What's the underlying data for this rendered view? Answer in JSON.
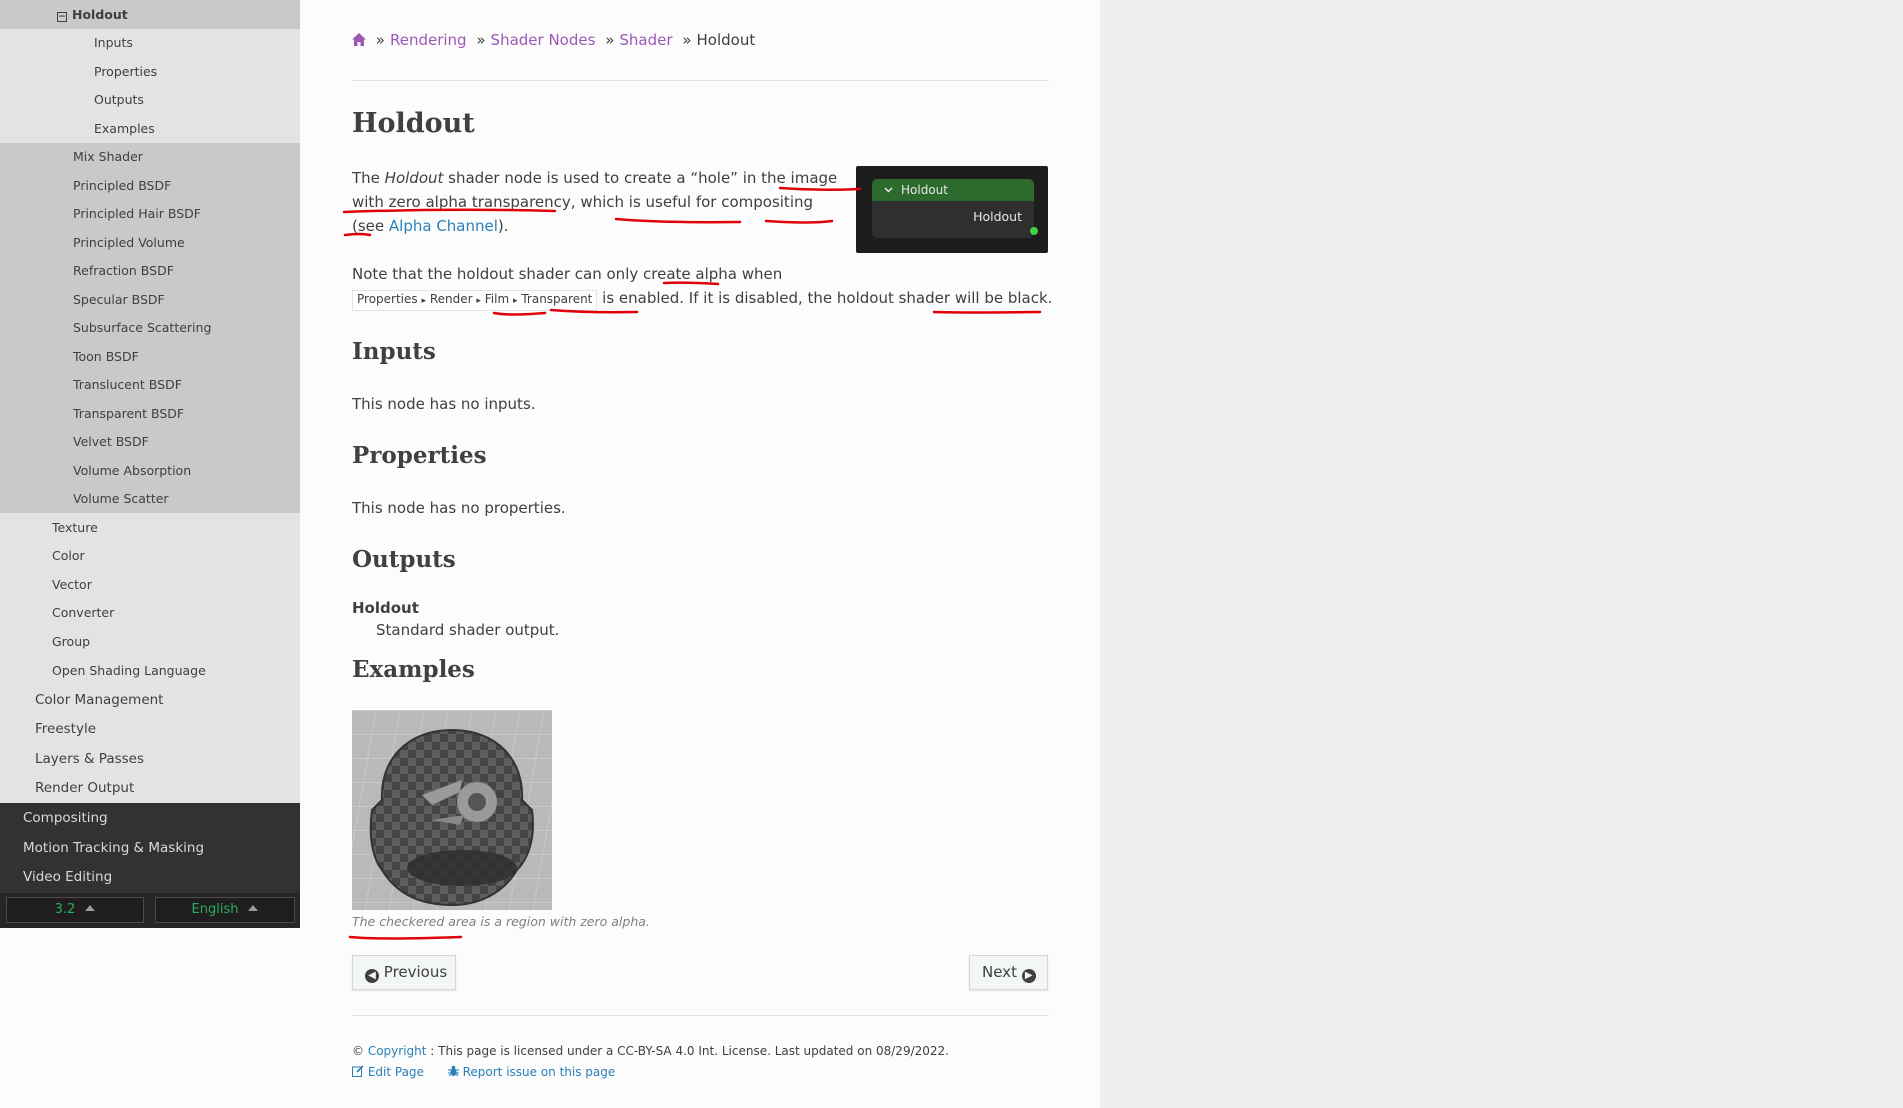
{
  "sidebar": {
    "holdout": "Holdout",
    "holdout_toggle": "−",
    "holdout_children": [
      "Inputs",
      "Properties",
      "Outputs",
      "Examples"
    ],
    "shaders": [
      "Mix Shader",
      "Principled BSDF",
      "Principled Hair BSDF",
      "Principled Volume",
      "Refraction BSDF",
      "Specular BSDF",
      "Subsurface Scattering",
      "Toon BSDF",
      "Translucent BSDF",
      "Transparent BSDF",
      "Velvet BSDF",
      "Volume Absorption",
      "Volume Scatter"
    ],
    "node_groups": [
      "Texture",
      "Color",
      "Vector",
      "Converter",
      "Group",
      "Open Shading Language"
    ],
    "rendering_items": [
      "Color Management",
      "Freestyle",
      "Layers & Passes",
      "Render Output"
    ],
    "top_items": [
      "Compositing",
      "Motion Tracking & Masking",
      "Video Editing"
    ],
    "version": "3.2",
    "language": "English"
  },
  "breadcrumbs": {
    "items": [
      "Rendering",
      "Shader Nodes",
      "Shader"
    ],
    "sep": "»",
    "current": "Holdout"
  },
  "page": {
    "title": "Holdout",
    "intro_1": "The ",
    "intro_em": "Holdout",
    "intro_2": " shader node is used to create a “hole” in the image with zero alpha transparency, which is useful for compositing (see ",
    "intro_link": "Alpha Channel",
    "intro_3": ").",
    "note_1": "Note that the holdout shader can only create alpha when",
    "menu_path": [
      "Properties",
      "Render",
      "Film",
      "Transparent"
    ],
    "menu_sep": "▸",
    "note_2": " is enabled. If it is disabled, the holdout shader will be black.",
    "inputs_title": "Inputs",
    "inputs_text": "This node has no inputs.",
    "properties_title": "Properties",
    "properties_text": "This node has no properties.",
    "outputs_title": "Outputs",
    "output_term": "Holdout",
    "output_def": "Standard shader output.",
    "examples_title": "Examples",
    "caption": "The checkered area is a region with zero alpha."
  },
  "node": {
    "header": "Holdout",
    "output": "Holdout",
    "header_color": "#2c6a2e",
    "socket_color": "#41d341"
  },
  "nav": {
    "previous": "Previous",
    "next": "Next"
  },
  "footer": {
    "copyright_symbol": "©",
    "copyright_link": "Copyright",
    "license_text": ": This page is licensed under a CC-BY-SA 4.0 Int. License. Last updated on 08/29/2022.",
    "edit_page": "Edit Page",
    "report_issue": "Report issue on this page"
  },
  "colors": {
    "link_visited": "#9b59b6",
    "link": "#2980b9",
    "annotation": "#e0000a"
  }
}
